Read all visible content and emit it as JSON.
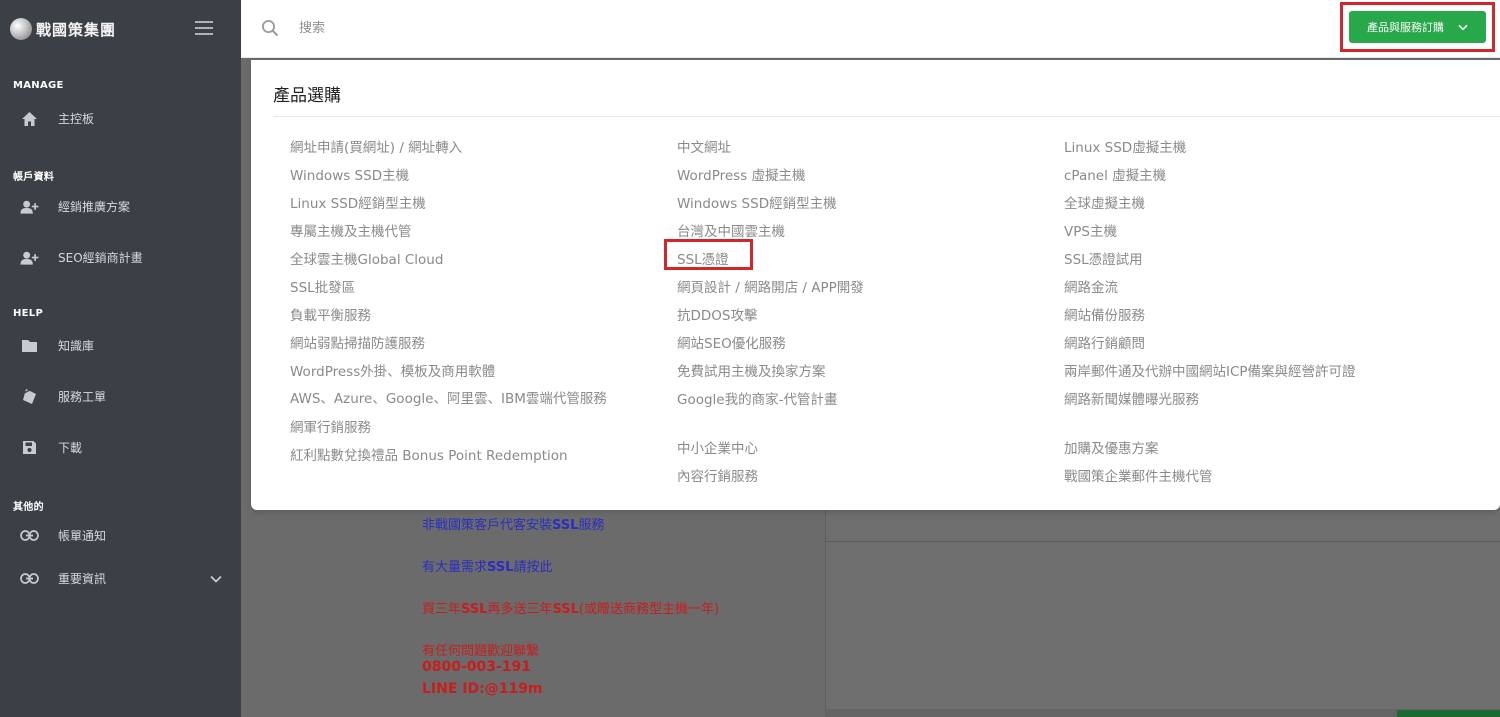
{
  "sidebar": {
    "logo_text": "戰國策集團",
    "sections": [
      {
        "title": "MANAGE",
        "items": [
          {
            "label": "主控板",
            "icon": "home-icon"
          }
        ]
      },
      {
        "title": "帳戶資料",
        "items": [
          {
            "label": "經銷推廣方案",
            "icon": "user-add-icon"
          },
          {
            "label": "SEO經銷商計畫",
            "icon": "user-add-icon"
          }
        ]
      },
      {
        "title": "HELP",
        "items": [
          {
            "label": "知識庫",
            "icon": "folder-icon"
          },
          {
            "label": "服務工單",
            "icon": "ticket-icon"
          },
          {
            "label": "下載",
            "icon": "save-icon"
          }
        ]
      },
      {
        "title": "其他的",
        "items": [
          {
            "label": "帳單通知",
            "icon": "link-icon"
          },
          {
            "label": "重要資訊",
            "icon": "link-icon"
          }
        ]
      }
    ]
  },
  "topbar": {
    "search_placeholder": "搜索",
    "order_button": "產品與服務訂購"
  },
  "dropdown": {
    "title": "產品選購",
    "columns": [
      [
        "網址申請(買網址) / 網址轉入",
        "Windows SSD主機",
        "Linux SSD經銷型主機",
        "專屬主機及主機代管",
        "全球雲主機Global Cloud",
        "SSL批發區",
        "負載平衡服務",
        "網站弱點掃描防護服務",
        "WordPress外掛、模板及商用軟體",
        "AWS、Azure、Google、阿里雲、IBM雲端代管服務",
        "網軍行銷服務",
        "紅利點數兌換禮品 Bonus Point Redemption"
      ],
      [
        "中文網址",
        "WordPress 虛擬主機",
        "Windows SSD經銷型主機",
        "台灣及中國雲主機",
        "SSL憑證",
        "網頁設計 / 網路開店 / APP開發",
        "抗DDOS攻擊",
        "網站SEO優化服務",
        "免費試用主機及換家方案",
        "Google我的商家-代管計畫",
        "中小企業中心",
        "內容行銷服務"
      ],
      [
        "Linux SSD虛擬主機",
        "cPanel 虛擬主機",
        "全球虛擬主機",
        "VPS主機",
        "SSL憑證試用",
        "網路金流",
        "網站備份服務",
        "網路行銷顧問",
        "兩岸郵件通及代辦中國網站ICP備案與經營許可證",
        "網路新聞媒體曝光服務",
        "加購及優惠方案",
        "戰國策企業郵件主機代管"
      ]
    ]
  },
  "background": {
    "line1_a": "非戰國策客戶代客安裝",
    "line1_b": "SSL",
    "line1_c": "服務",
    "line2_a": "有大量需求",
    "line2_b": "SSL",
    "line2_c": "請按此",
    "line3_a": "買三年",
    "line3_b": "SSL",
    "line3_c": "再多送三年",
    "line3_d": "SSL",
    "line3_e": "(或贈送商務型主機一年)",
    "line4": "有任何問題歡迎聯繫",
    "phone": "0800-003-191",
    "line_id": "LINE ID:@119m"
  },
  "colors": {
    "sidebar_bg": "#3b3f46",
    "accent_green": "#27a84a",
    "highlight_red": "#d3262a"
  }
}
